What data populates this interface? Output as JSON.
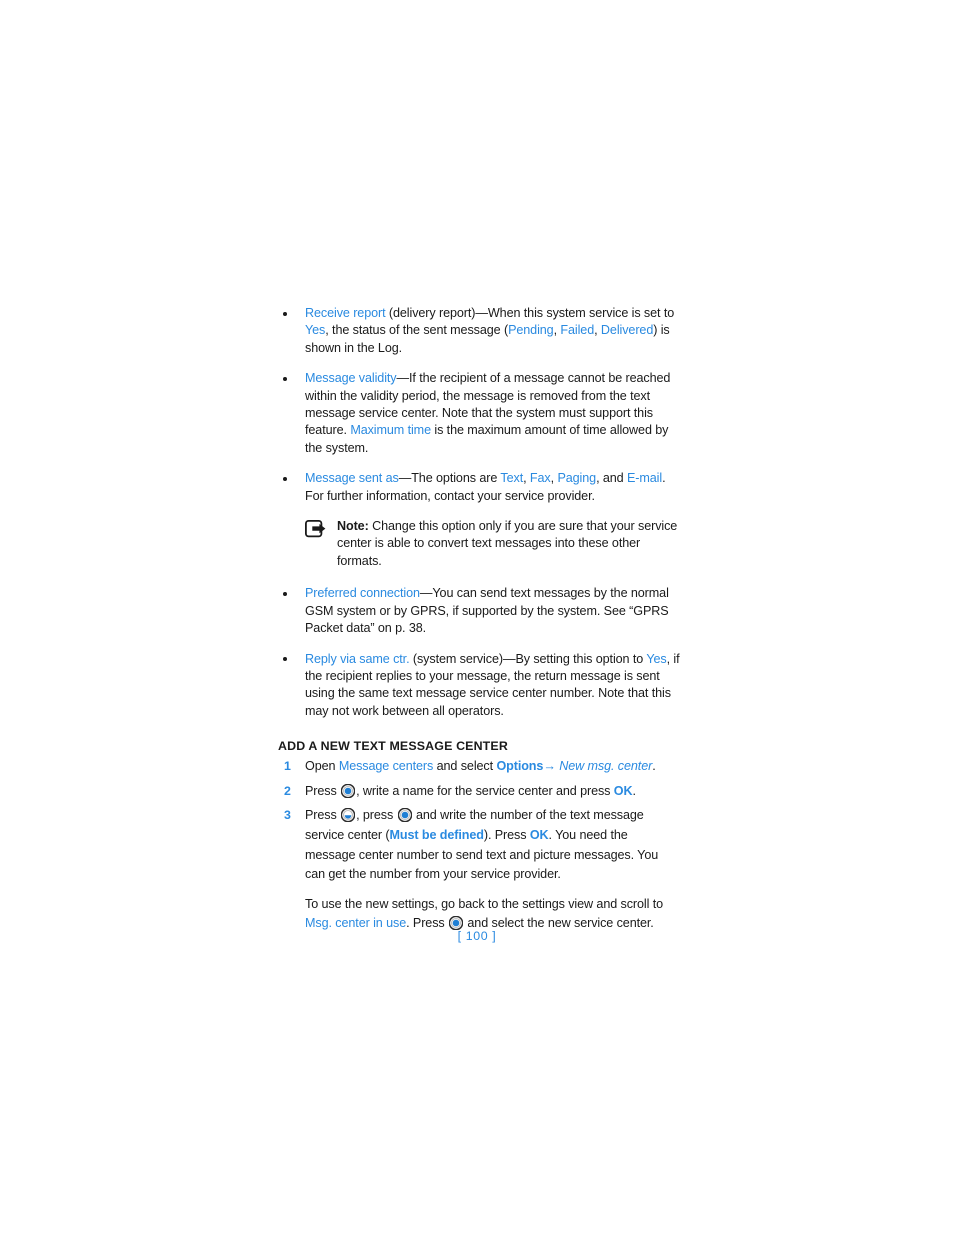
{
  "document": {
    "type": "manual-page",
    "page_label": "[ 100 ]",
    "accent_color": "#2a8ae0",
    "text_color": "#1a1a1a"
  },
  "bullets": [
    {
      "id": "receive-report",
      "parts": [
        {
          "text": "Receive report",
          "style": "link"
        },
        {
          "text": " (delivery report)—When this system service is set to ",
          "style": "plain"
        },
        {
          "text": "Yes",
          "style": "link"
        },
        {
          "text": ", the status of the sent message (",
          "style": "plain"
        },
        {
          "text": "Pending",
          "style": "link"
        },
        {
          "text": ", ",
          "style": "plain"
        },
        {
          "text": "Failed",
          "style": "link"
        },
        {
          "text": ", ",
          "style": "plain"
        },
        {
          "text": "Delivered",
          "style": "link"
        },
        {
          "text": ") is shown in the Log.",
          "style": "plain"
        }
      ]
    },
    {
      "id": "message-validity",
      "parts": [
        {
          "text": "Message validity",
          "style": "link"
        },
        {
          "text": "—If the recipient of a message cannot be reached within the validity period, the message is removed from the text message service center. Note that the system must support this feature. ",
          "style": "plain"
        },
        {
          "text": "Maximum time",
          "style": "link"
        },
        {
          "text": " is the maximum amount of time allowed by the system.",
          "style": "plain"
        }
      ]
    },
    {
      "id": "message-sent-as",
      "parts": [
        {
          "text": "Message sent as",
          "style": "link"
        },
        {
          "text": "—The options are ",
          "style": "plain"
        },
        {
          "text": "Text",
          "style": "link"
        },
        {
          "text": ", ",
          "style": "plain"
        },
        {
          "text": "Fax",
          "style": "link"
        },
        {
          "text": ", ",
          "style": "plain"
        },
        {
          "text": "Paging",
          "style": "link"
        },
        {
          "text": ", and ",
          "style": "plain"
        },
        {
          "text": "E-mail",
          "style": "link"
        },
        {
          "text": ". For further information, contact your service provider.",
          "style": "plain"
        }
      ]
    },
    {
      "id": "preferred-connection",
      "parts": [
        {
          "text": "Preferred connection",
          "style": "link"
        },
        {
          "text": "—You can send text messages by the normal GSM system or by GPRS, if supported by the system. See “GPRS Packet data” on p. 38.",
          "style": "plain"
        }
      ]
    },
    {
      "id": "reply-via-same-ctr",
      "parts": [
        {
          "text": "Reply via same ctr.",
          "style": "link"
        },
        {
          "text": " (system service)—By setting this option to ",
          "style": "plain"
        },
        {
          "text": "Yes",
          "style": "link"
        },
        {
          "text": ", if the recipient replies to your message, the return message is sent using the same text message service center number. Note that this may not work between all operators.",
          "style": "plain"
        }
      ]
    }
  ],
  "note": {
    "icon_name": "note-pointer-icon",
    "label": "Note:",
    "body": " Change this option only if you are sure that your service center is able to convert text messages into these other formats."
  },
  "section": {
    "heading": "ADD A NEW TEXT MESSAGE CENTER",
    "steps": [
      {
        "number": "1",
        "parts": [
          {
            "text": "Open ",
            "style": "plain"
          },
          {
            "text": "Message centers",
            "style": "link"
          },
          {
            "text": " and select ",
            "style": "plain"
          },
          {
            "text": "Options",
            "style": "link-bold"
          },
          {
            "text": "→",
            "style": "link-bold"
          },
          {
            "text": " ",
            "style": "plain"
          },
          {
            "text": "New msg. center",
            "style": "link-italic"
          },
          {
            "text": ".",
            "style": "plain"
          }
        ]
      },
      {
        "number": "2",
        "parts": [
          {
            "text": "Press ",
            "style": "plain"
          },
          {
            "text": "",
            "style": "icon-joystick-select"
          },
          {
            "text": ", write a name for the service center and press ",
            "style": "plain"
          },
          {
            "text": "OK",
            "style": "link-bold"
          },
          {
            "text": ".",
            "style": "plain"
          }
        ]
      },
      {
        "number": "3",
        "parts": [
          {
            "text": "Press ",
            "style": "plain"
          },
          {
            "text": "",
            "style": "icon-joystick-down"
          },
          {
            "text": ", press ",
            "style": "plain"
          },
          {
            "text": "",
            "style": "icon-joystick-select"
          },
          {
            "text": " and write the number of the text message service center (",
            "style": "plain"
          },
          {
            "text": "Must be defined",
            "style": "link-bold"
          },
          {
            "text": "). Press ",
            "style": "plain"
          },
          {
            "text": "OK",
            "style": "link-bold"
          },
          {
            "text": ". You need the message center number to send text and picture messages. You can get the number from your service provider.",
            "style": "plain"
          }
        ],
        "sub_parts": [
          {
            "text": "To use the new settings, go back to the settings view and scroll to ",
            "style": "plain"
          },
          {
            "text": "Msg. center in use",
            "style": "link"
          },
          {
            "text": ". Press ",
            "style": "plain"
          },
          {
            "text": "",
            "style": "icon-joystick-select"
          },
          {
            "text": " and select the new service center.",
            "style": "plain"
          }
        ]
      }
    ]
  }
}
